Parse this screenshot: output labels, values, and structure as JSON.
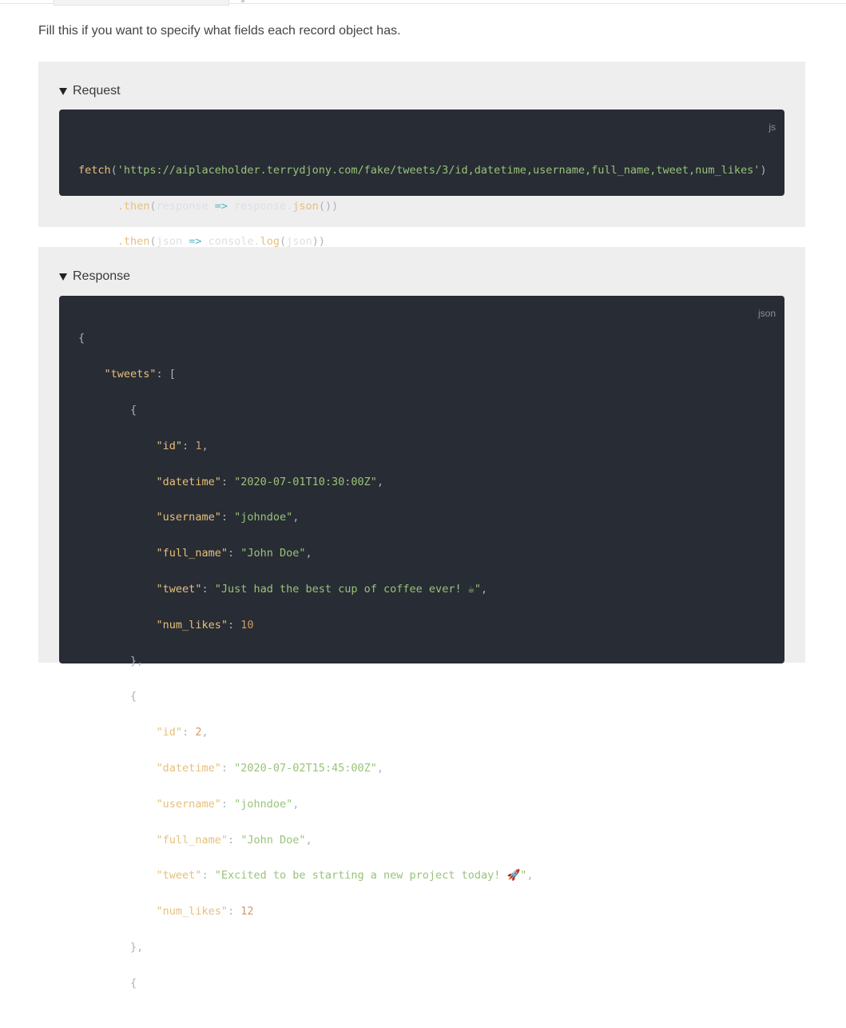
{
  "intro_text": "Fill this if you want to specify what fields each record object has.",
  "request": {
    "summary_label": "Request",
    "lang": "js",
    "code": {
      "fetch": "fetch",
      "url": "'https://aiplaceholder.terrydjony.com/fake/tweets/3/id,datetime,username,full_name,tweet,num_likes'",
      "then1_method": ".then",
      "then1_arg": "response",
      "then1_call": "response.",
      "then1_fn": "json",
      "then2_method": ".then",
      "then2_arg": "json",
      "then2_call": "console.",
      "then2_fn": "log",
      "then2_param": "json"
    }
  },
  "response": {
    "summary_label": "Response",
    "lang": "json",
    "root_key": "\"tweets\"",
    "records": [
      {
        "id": "1",
        "datetime": "\"2020-07-01T10:30:00Z\"",
        "username": "\"johndoe\"",
        "full_name": "\"John Doe\"",
        "tweet": "\"Just had the best cup of coffee ever! ☕\"",
        "num_likes": "10"
      },
      {
        "id": "2",
        "datetime": "\"2020-07-02T15:45:00Z\"",
        "username": "\"johndoe\"",
        "full_name": "\"John Doe\"",
        "tweet": "\"Excited to be starting a new project today! 🚀\"",
        "num_likes": "12"
      }
    ],
    "keys": {
      "id": "\"id\"",
      "datetime": "\"datetime\"",
      "username": "\"username\"",
      "full_name": "\"full_name\"",
      "tweet": "\"tweet\"",
      "num_likes": "\"num_likes\""
    }
  }
}
